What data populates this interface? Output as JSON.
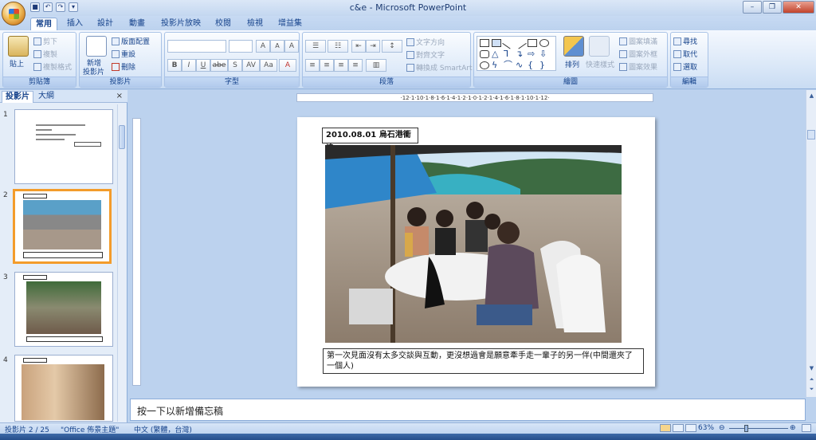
{
  "window": {
    "title": "c&e - Microsoft PowerPoint",
    "min": "–",
    "max": "❐",
    "close": "✕"
  },
  "qat": {
    "save": "■",
    "undo": "↶",
    "redo": "↷",
    "custom": "▾"
  },
  "ribbon_tabs": [
    "常用",
    "插入",
    "設計",
    "動畫",
    "投影片放映",
    "校閱",
    "檢視",
    "增益集"
  ],
  "groups": {
    "clipboard": {
      "label": "剪貼簿",
      "paste": "貼上",
      "cut": "剪下",
      "copy": "複製",
      "format_painter": "複製格式"
    },
    "slides": {
      "label": "投影片",
      "new_slide": "新增",
      "new_slide2": "投影片",
      "layout": "版面配置",
      "reset": "重設",
      "delete": "刪除"
    },
    "font": {
      "label": "字型",
      "grow": "A",
      "shrink": "A",
      "clear": "A",
      "bold": "B",
      "italic": "I",
      "underline": "U",
      "abe": "abe",
      "shadow": "S",
      "spacing": "AV",
      "case": "Aa",
      "color": "A"
    },
    "paragraph": {
      "label": "段落",
      "text_direction": "文字方向",
      "align_text": "對齊文字",
      "smartart": "轉換成 SmartArt"
    },
    "drawing": {
      "label": "繪圖",
      "arrange": "排列",
      "quick_styles": "快速樣式",
      "fill": "圖案填滿",
      "outline": "圖案外框",
      "effects": "圖案效果"
    },
    "editing": {
      "label": "編輯",
      "find": "尋找",
      "replace": "取代",
      "select": "選取"
    }
  },
  "panel_tabs": {
    "slides": "投影片",
    "outline": "大綱",
    "close": "×"
  },
  "thumbnails": [
    {
      "num": "1"
    },
    {
      "num": "2"
    },
    {
      "num": "3"
    },
    {
      "num": "4"
    }
  ],
  "ruler": {
    "h": "·12·1·10·1·8·1·6·1·4·1·2·1·0·1·2·1·4·1·6·1·8·1·10·1·12·"
  },
  "slide": {
    "title": "2010.08.01  烏石港衝浪",
    "caption": "第一次見面沒有太多交談與互動，更沒想過會是願意牽手走一輩子的另一伴(中間還夾了一個人)"
  },
  "notes": {
    "placeholder": "按一下以新增備忘稿"
  },
  "status": {
    "slide_num": "投影片 2 / 25",
    "theme": "\"Office 佈景主題\"",
    "language": "中文 (繁體，台灣)",
    "zoom": "63%",
    "zoom_minus": "⊖",
    "zoom_plus": "⊕"
  },
  "colors": {
    "accent": "#15428b",
    "selected": "#f39c2b"
  }
}
